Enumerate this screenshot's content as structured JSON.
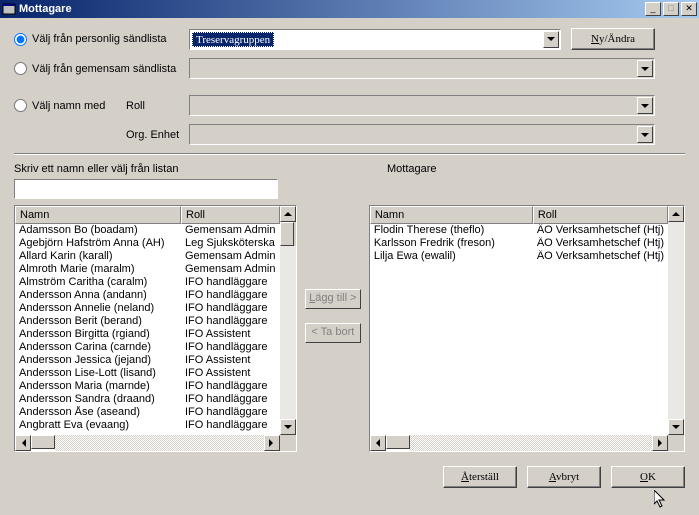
{
  "title": "Mottagare",
  "radios": {
    "personal": "Välj från personlig sändlista",
    "shared": "Välj från gemensam sändlista",
    "byname": "Välj namn med"
  },
  "sublabels": {
    "role": "Roll",
    "org": "Org. Enhet"
  },
  "combo_personal_selected": "Treservagruppen",
  "btn_nyandra": "Ny/Ändra",
  "section": {
    "left_label": "Skriv ett namn eller välj från listan",
    "right_label": "Mottagare"
  },
  "headers": {
    "name": "Namn",
    "role": "Roll"
  },
  "left_list": [
    {
      "n": "Adamsson Bo (boadam)",
      "r": "Gemensam Admin"
    },
    {
      "n": "Agebjörn Hafström Anna (AH)",
      "r": "Leg Sjuksköterska"
    },
    {
      "n": "Allard Karin (karall)",
      "r": "Gemensam Admin"
    },
    {
      "n": "Almroth Marie (maralm)",
      "r": "Gemensam Admin"
    },
    {
      "n": "Almström Caritha (caralm)",
      "r": "IFO handläggare"
    },
    {
      "n": "Andersson Anna (andann)",
      "r": "IFO handläggare"
    },
    {
      "n": "Andersson Annelie (neland)",
      "r": "IFO handläggare"
    },
    {
      "n": "Andersson Berit (berand)",
      "r": "IFO handläggare"
    },
    {
      "n": "Andersson Birgitta (rgiand)",
      "r": "IFO Assistent"
    },
    {
      "n": "Andersson Carina (carnde)",
      "r": "IFO handläggare"
    },
    {
      "n": "Andersson Jessica (jejand)",
      "r": "IFO Assistent"
    },
    {
      "n": "Andersson Lise-Lott (lisand)",
      "r": "IFO Assistent"
    },
    {
      "n": "Andersson Maria (marnde)",
      "r": "IFO handläggare"
    },
    {
      "n": "Andersson Sandra (draand)",
      "r": "IFO handläggare"
    },
    {
      "n": "Andersson Åse (aseand)",
      "r": "IFO handläggare"
    },
    {
      "n": "Angbratt Eva (evaang)",
      "r": "IFO handläggare"
    }
  ],
  "right_list": [
    {
      "n": "Flodin Therese (theflo)",
      "r": "ÄO Verksamhetschef (Htj)"
    },
    {
      "n": "Karlsson Fredrik (freson)",
      "r": "ÄO Verksamhetschef (Htj)"
    },
    {
      "n": "Lilja Ewa (ewalil)",
      "r": "ÄO Verksamhetschef (Htj)"
    }
  ],
  "xfer": {
    "add": "Lägg till >",
    "remove": "< Ta bort"
  },
  "footer": {
    "reset": "Återställ",
    "cancel": "Avbryt",
    "ok": "OK"
  }
}
